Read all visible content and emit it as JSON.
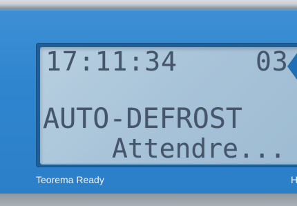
{
  "display": {
    "clock": "17:11:34",
    "code": "03",
    "line1": "AUTO-DEFROST",
    "line2": "Attendre..."
  },
  "panel": {
    "brand_label": "Teorema Ready",
    "right_label": "H"
  },
  "colors": {
    "panel_blue": "#2f86cf",
    "lcd_background": "#a9c4d9",
    "lcd_text": "#46566a",
    "label_text": "#eaf3fb"
  }
}
